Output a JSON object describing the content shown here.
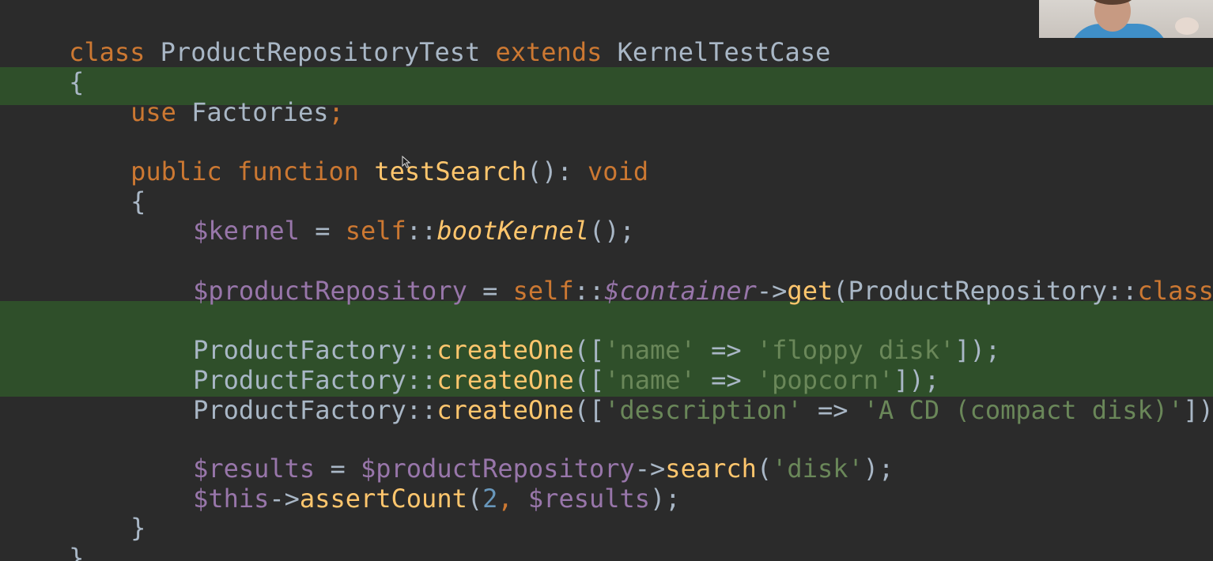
{
  "code": {
    "class_kw": "class",
    "class_name": "ProductRepositoryTest",
    "extends_kw": "extends",
    "parent_class": "KernelTestCase",
    "open_brace_class": "{",
    "use_kw": "use",
    "trait_name": "Factories",
    "semicolon": ";",
    "public_kw": "public",
    "function_kw": "function",
    "method_name": "testSearch",
    "method_sig_rest": "(): ",
    "void_kw": "void",
    "open_brace_method": "{",
    "kernel_var": "$kernel",
    "assign": " = ",
    "self_kw": "self",
    "scope_op": "::",
    "boot_kernel": "bootKernel",
    "call_end": "();",
    "repo_var": "$productRepository",
    "container_prop": "$container",
    "arrow": "->",
    "get_fn": "get",
    "repo_class_arg": "(ProductRepository::",
    "class_const": "class",
    "call_close": ");",
    "factory_class": "ProductFactory",
    "create_one": "createOne",
    "lines_factory": [
      {
        "key": "'name'",
        "value": "'floppy disk'"
      },
      {
        "key": "'name'",
        "value": "'popcorn'"
      },
      {
        "key": "'description'",
        "value": "'A CD (compact disk)'"
      }
    ],
    "open_args": "([",
    "fat_arrow": " => ",
    "close_args": "]);",
    "results_var": "$results",
    "search_fn": "search",
    "search_arg": "'disk'",
    "this_var": "$this",
    "assert_fn": "assertCount",
    "count_num": "2",
    "comma": ", ",
    "close_brace_method": "}",
    "close_brace_class": "}"
  },
  "colors": {
    "background": "#2b2b2b",
    "highlight": "#2f4f2a",
    "keyword": "#cc7832",
    "function": "#ffc66d",
    "variable": "#9876aa",
    "string": "#6a8759",
    "number": "#6897bb",
    "text": "#a9b7c6"
  },
  "icons": {
    "cursor": "mouse-pointer-icon"
  }
}
